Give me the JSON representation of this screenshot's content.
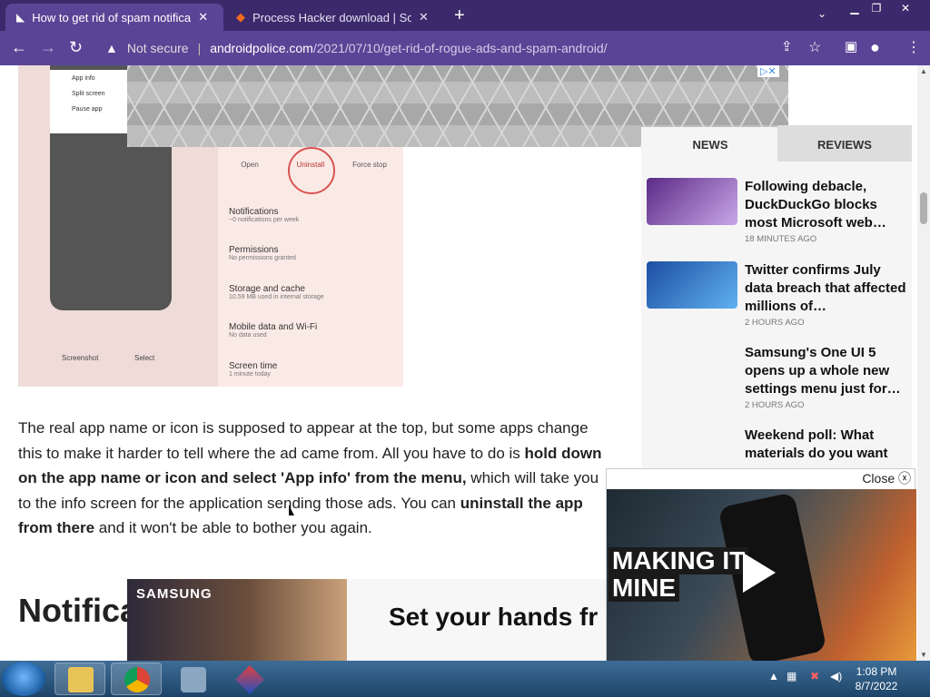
{
  "browser": {
    "tabs": [
      {
        "title": "How to get rid of spam notificati",
        "active": true
      },
      {
        "title": "Process Hacker download | Sourc",
        "active": false
      }
    ],
    "new_tab": "+",
    "address": {
      "security": "Not secure",
      "host": "androidpolice.com",
      "path": "/2021/07/10/get-rid-of-rogue-ads-and-spam-android/"
    }
  },
  "screenshot": {
    "menu": [
      "App info",
      "Split screen",
      "Pause app"
    ],
    "actions": [
      "Open",
      "Uninstall",
      "Force stop"
    ],
    "rows": [
      {
        "title": "Notifications",
        "sub": "~0 notifications per week"
      },
      {
        "title": "Permissions",
        "sub": "No permissions granted"
      },
      {
        "title": "Storage and cache",
        "sub": "10.59 MB used in internal storage"
      },
      {
        "title": "Mobile data and Wi-Fi",
        "sub": "No data used"
      },
      {
        "title": "Screen time",
        "sub": "1 minute today"
      }
    ],
    "footer": [
      "Screenshot",
      "Select"
    ]
  },
  "article": {
    "p1": "The real app name or icon is supposed to appear at the top, but some apps change this to make it harder to tell where the ad came from. All you have to do is ",
    "b1": "hold down on the app name or icon and select 'App info' from the menu,",
    "p2": " which will take you to the info screen for the application sending those ads. You can ",
    "b2": "uninstall the app from there",
    "p3": " and it won't be able to bother you again.",
    "heading": "Notifica"
  },
  "sidebar": {
    "tabs": [
      "NEWS",
      "REVIEWS"
    ],
    "items": [
      {
        "title": "Following debacle, DuckDuckGo blocks most Microsoft web…",
        "time": "18 MINUTES AGO"
      },
      {
        "title": "Twitter confirms July data breach that affected millions of…",
        "time": "2 HOURS AGO"
      },
      {
        "title": "Samsung's One UI 5 opens up a whole new settings menu just for…",
        "time": "2 HOURS AGO"
      },
      {
        "title": "Weekend poll: What materials do you want",
        "time": ""
      }
    ]
  },
  "video": {
    "close": "Close",
    "caption1": "MAKING IT",
    "caption2": "MINE"
  },
  "ad_bottom": {
    "brand": "SAMSUNG",
    "slogan": "Set your hands fr"
  },
  "taskbar": {
    "time": "1:08 PM",
    "date": "8/7/2022"
  },
  "colors": {
    "titlebar": "#3b2a6b",
    "toolbar": "#5a4496",
    "taskbar": "#2a5580"
  }
}
